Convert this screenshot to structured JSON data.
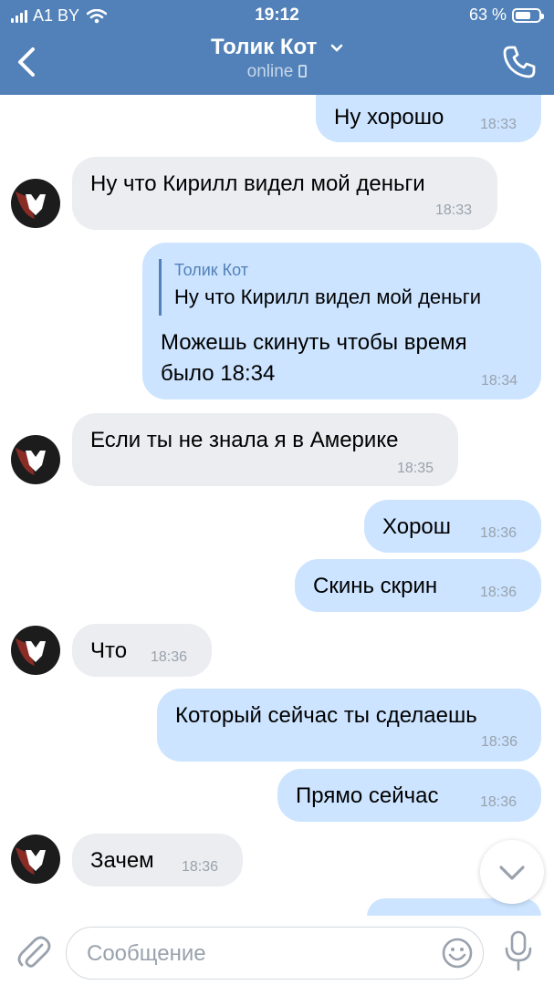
{
  "status_bar": {
    "carrier": "A1 BY",
    "time": "19:12",
    "battery": "63 %",
    "battery_level": 0.63
  },
  "header": {
    "title": "Толик Кот",
    "status": "online"
  },
  "messages": [
    {
      "id": 0,
      "dir": "out",
      "text": "Ну хорошо",
      "time": "18:33"
    },
    {
      "id": 1,
      "dir": "in",
      "text": "Ну что Кирилл видел мой деньги",
      "time": "18:33"
    },
    {
      "id": 2,
      "dir": "out",
      "reply": {
        "author": "Толик Кот",
        "text": "Ну что Кирилл видел мой деньги"
      },
      "lines": [
        "Можешь скинуть чтобы время",
        "было 18:34"
      ],
      "time": "18:34"
    },
    {
      "id": 3,
      "dir": "in",
      "text": "Если ты не знала я в Америке",
      "time": "18:35"
    },
    {
      "id": 4,
      "dir": "out",
      "text": "Хорош",
      "time": "18:36"
    },
    {
      "id": 5,
      "dir": "out",
      "text": "Скинь скрин",
      "time": "18:36"
    },
    {
      "id": 6,
      "dir": "in",
      "text": "Что",
      "time": "18:36"
    },
    {
      "id": 7,
      "dir": "out",
      "text": "Который сейчас ты сделаешь",
      "time": "18:36"
    },
    {
      "id": 8,
      "dir": "out",
      "text": "Прямо сейчас",
      "time": "18:36"
    },
    {
      "id": 9,
      "dir": "in",
      "text": "Зачем",
      "time": "18:36"
    }
  ],
  "input": {
    "placeholder": "Сообщение",
    "value": ""
  },
  "colors": {
    "header": "#5181b8",
    "outgoing": "#cce4ff",
    "incoming": "#ebedf0",
    "time": "#99a2ad",
    "reply_accent": "#5181b8"
  },
  "icons": [
    "back-arrow-icon",
    "chevron-down-icon",
    "mobile-phone-icon",
    "phone-call-icon",
    "paperclip-icon",
    "smile-icon",
    "microphone-icon",
    "chevron-down-icon",
    "signal-bars-icon",
    "wifi-icon",
    "battery-icon"
  ]
}
